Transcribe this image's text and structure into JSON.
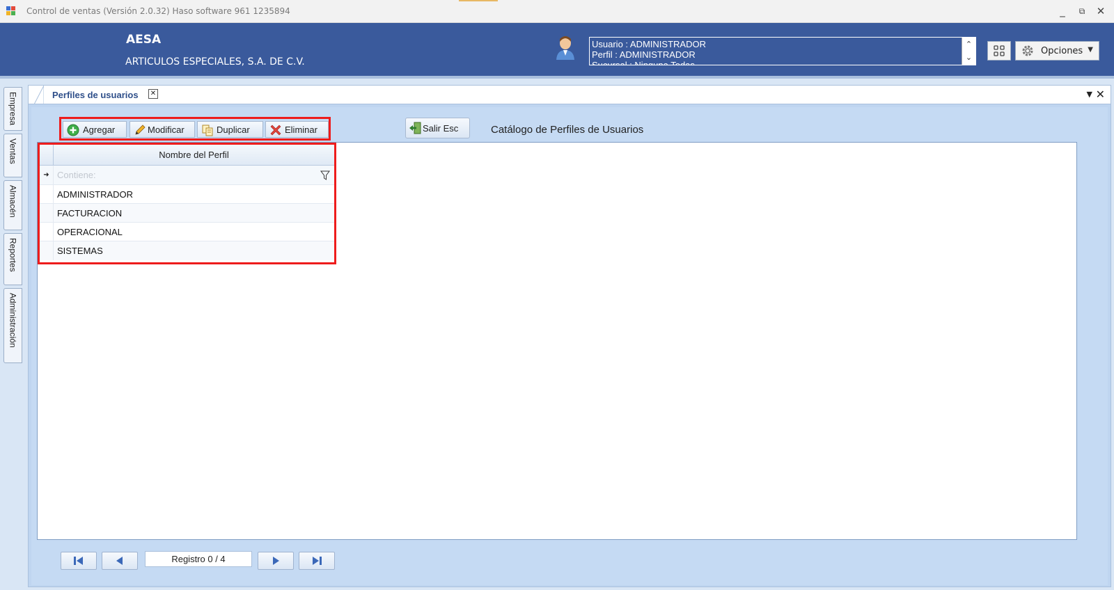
{
  "window": {
    "title": "Control de ventas  (Versión 2.0.32)  Haso software  961 1235894",
    "controls": {
      "minimize": "_",
      "restore": "⧉",
      "close": "✕"
    }
  },
  "header": {
    "company_short": "AESA",
    "company_long": "ARTICULOS ESPECIALES, S.A. DE C.V.",
    "user_info": {
      "line1": "Usuario : ADMINISTRADOR",
      "line2": "Perfil : ADMINISTRADOR",
      "line3": "Sucursal : Ninguna  Todas"
    },
    "options_label": "Opciones"
  },
  "side_tabs": [
    "Empresa",
    "Ventas",
    "Almacén",
    "Reportes",
    "Administración"
  ],
  "document": {
    "tab_label": "Perfiles de usuarios",
    "tab_close": "✕",
    "toolbar": {
      "add_label": "Agregar",
      "edit_label": "Modificar",
      "duplicate_label": "Duplicar",
      "delete_label": "Eliminar",
      "exit_label": "Salir  Esc"
    },
    "catalog_title": "Catálogo de Perfiles de Usuarios",
    "grid": {
      "column": "Nombre del Perfil",
      "filter_placeholder": "Contiene:",
      "rows": [
        "ADMINISTRADOR",
        "FACTURACION",
        "OPERACIONAL",
        "SISTEMAS"
      ]
    },
    "navigator": {
      "record_label": "Registro  0 / 4"
    }
  },
  "colors": {
    "banner": "#3a5a9c",
    "highlight": "#ee1c1c",
    "panel": "#c5daf3"
  },
  "icons": [
    "app-icon",
    "avatar-icon",
    "grid-icon",
    "gear-icon",
    "add-icon",
    "pencil-icon",
    "duplicate-icon",
    "delete-icon",
    "exit-icon",
    "filter-icon",
    "first-icon",
    "prev-icon",
    "next-icon",
    "last-icon"
  ]
}
